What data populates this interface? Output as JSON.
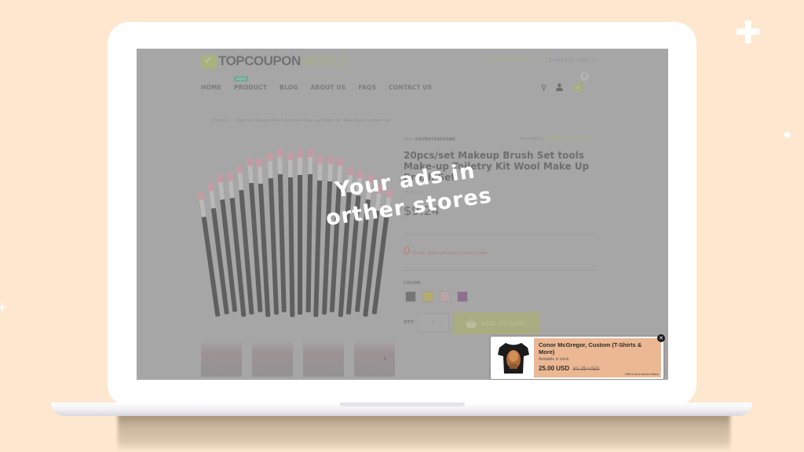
{
  "decor": {
    "plus_icon": "✚",
    "small_plus": "+"
  },
  "store": {
    "logo": {
      "part1": "TOPCOUPON",
      "part2": "WORLD"
    },
    "welcome": "Default welcome msg!",
    "currency": {
      "label": "Currency:",
      "value": "USD",
      "caret": "▾"
    },
    "nav": [
      {
        "label": "HOME"
      },
      {
        "label": "PRODUCT",
        "badge": "SALE"
      },
      {
        "label": "BLOG"
      },
      {
        "label": "ABOUT US"
      },
      {
        "label": "FAQS"
      },
      {
        "label": "CONTACT US"
      }
    ],
    "icons": {
      "search": "⚲",
      "user": "👤",
      "cart": "🧺",
      "cart_count": "0"
    },
    "breadcrumb": {
      "home_icon": "⌂",
      "items": [
        "Products",
        "20pcs/set Makeup Brush Set tools Make-up Toiletry Kit Wool Make Up Brush Set"
      ]
    }
  },
  "product": {
    "sku_label": "SKU:",
    "sku": "GSY60729603BK",
    "availability_label": "Availability:",
    "availability": "undefined in stock",
    "title": "20pcs/set Makeup Brush Set tools Make-up Toiletry Kit Wool Make Up Brush Set",
    "brand": "alishoppi",
    "price": "$9.24",
    "stock_count": "0",
    "hurry_text": "Hurry, there are only 0 item(s) left!",
    "color_label": "COLOR:",
    "colors": [
      "#767676",
      "#b4ab72",
      "#b9a4a8",
      "#8f6f91"
    ],
    "qty_label": "QTY:",
    "qty_value": "1",
    "add_to_cart": "ADD TO CART",
    "thumb_prev": "‹",
    "thumb_next": "›"
  },
  "overlay": {
    "line1": "Your ads in",
    "line2": "orther stores"
  },
  "popup_ad": {
    "title": "Conor McGregor, Custom (T-Shirts & More)",
    "stock": "Available in stock",
    "price": "25.00 USD",
    "old_price": "31.25 USD",
    "offer": "Offers from Ashen Black",
    "close_icon": "✕"
  }
}
